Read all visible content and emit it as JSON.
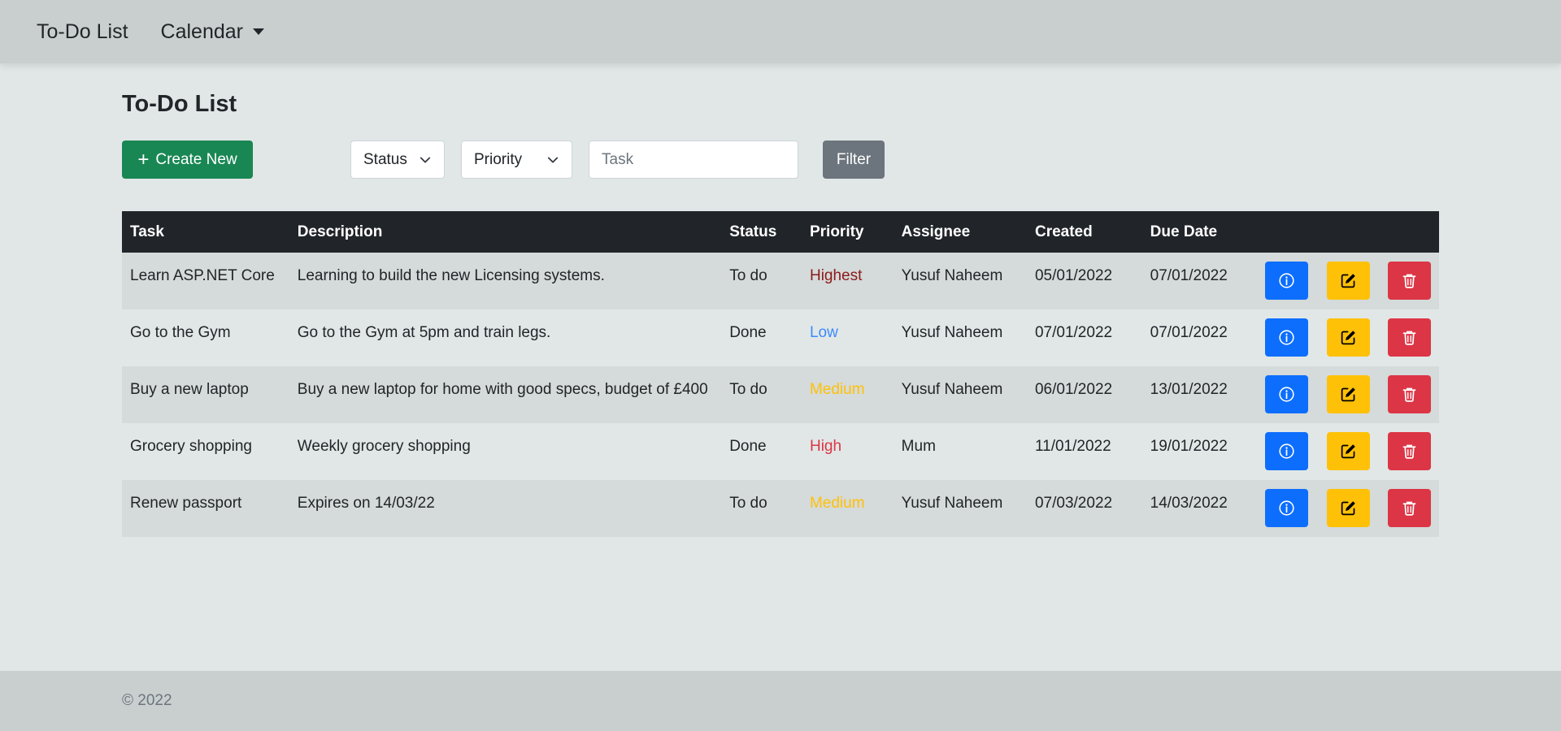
{
  "nav": {
    "brand": "To-Do List",
    "calendar": "Calendar"
  },
  "page": {
    "title": "To-Do List"
  },
  "toolbar": {
    "create_label": "Create New",
    "status_select": "Status",
    "priority_select": "Priority",
    "task_placeholder": "Task",
    "filter_label": "Filter"
  },
  "table": {
    "headers": [
      "Task",
      "Description",
      "Status",
      "Priority",
      "Assignee",
      "Created",
      "Due Date"
    ],
    "rows": [
      {
        "task": "Learn ASP.NET Core",
        "description": "Learning to build the new Licensing systems.",
        "status": "To do",
        "priority": "Highest",
        "assignee": "Yusuf Naheem",
        "created": "05/01/2022",
        "due": "07/01/2022"
      },
      {
        "task": "Go to the Gym",
        "description": "Go to the Gym at 5pm and train legs.",
        "status": "Done",
        "priority": "Low",
        "assignee": "Yusuf Naheem",
        "created": "07/01/2022",
        "due": "07/01/2022"
      },
      {
        "task": "Buy a new laptop",
        "description": "Buy a new laptop for home with good specs, budget of £400",
        "status": "To do",
        "priority": "Medium",
        "assignee": "Yusuf Naheem",
        "created": "06/01/2022",
        "due": "13/01/2022"
      },
      {
        "task": "Grocery shopping",
        "description": "Weekly grocery shopping",
        "status": "Done",
        "priority": "High",
        "assignee": "Mum",
        "created": "11/01/2022",
        "due": "19/01/2022"
      },
      {
        "task": "Renew passport",
        "description": "Expires on 14/03/22",
        "status": "To do",
        "priority": "Medium",
        "assignee": "Yusuf Naheem",
        "created": "07/03/2022",
        "due": "14/03/2022"
      }
    ]
  },
  "priority_colors": {
    "Highest": "#8b1a1a",
    "High": "#dc3545",
    "Medium": "#ffc107",
    "Low": "#3d8bfd"
  },
  "icons": {
    "info": "info-circle-icon",
    "edit": "pencil-square-icon",
    "delete": "trash-icon"
  },
  "footer": {
    "text": "© 2022"
  }
}
